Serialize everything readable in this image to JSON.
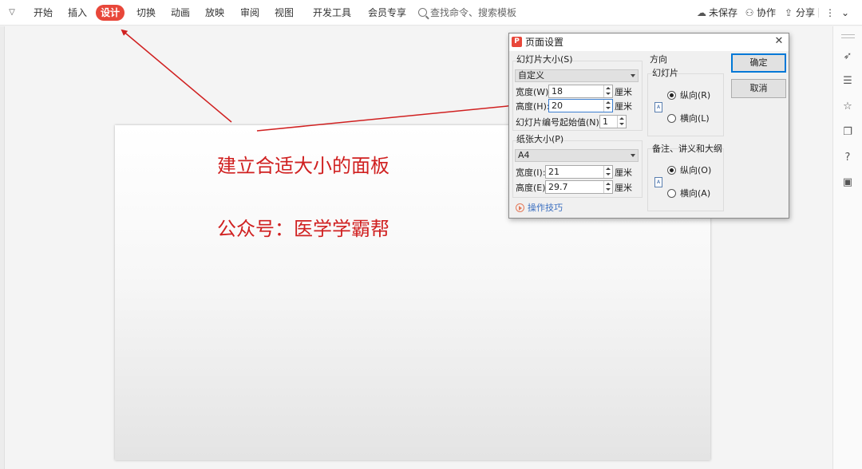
{
  "ribbon": {
    "tabs": [
      "开始",
      "插入",
      "设计",
      "切换",
      "动画",
      "放映",
      "审阅",
      "视图",
      "开发工具",
      "会员专享"
    ],
    "active_tab": "设计",
    "search_placeholder": "查找命令、搜索模板",
    "unsaved": "未保存",
    "collaborate": "协作",
    "share": "分享"
  },
  "slide": {
    "line1": "建立合适大小的面板",
    "line2": "公众号：医学学霸帮"
  },
  "dialog": {
    "logo": "P",
    "title": "页面设置",
    "slide_size_label": "幻灯片大小(S)",
    "slide_size_value": "自定义",
    "width_label": "宽度(W):",
    "width_value": "18",
    "height_label": "高度(H):",
    "height_value": "20",
    "unit": "厘米",
    "numbering_label": "幻灯片编号起始值(N):",
    "numbering_value": "1",
    "paper_label": "纸张大小(P)",
    "paper_value": "A4",
    "paper_width_label": "宽度(I):",
    "paper_width_value": "21",
    "paper_height_label": "高度(E):",
    "paper_height_value": "29.7",
    "orientation_label": "方向",
    "slides_label": "幻灯片",
    "portrait_label": "纵向(R)",
    "landscape_label": "横向(L)",
    "notes_label": "备注、讲义和大纲",
    "notes_portrait_label": "纵向(O)",
    "notes_landscape_label": "横向(A)",
    "ok": "确定",
    "cancel": "取消",
    "tips": "操作技巧"
  },
  "colors": {
    "accent": "#e8473a",
    "annotation": "#d02020",
    "link": "#3b6fc0"
  }
}
